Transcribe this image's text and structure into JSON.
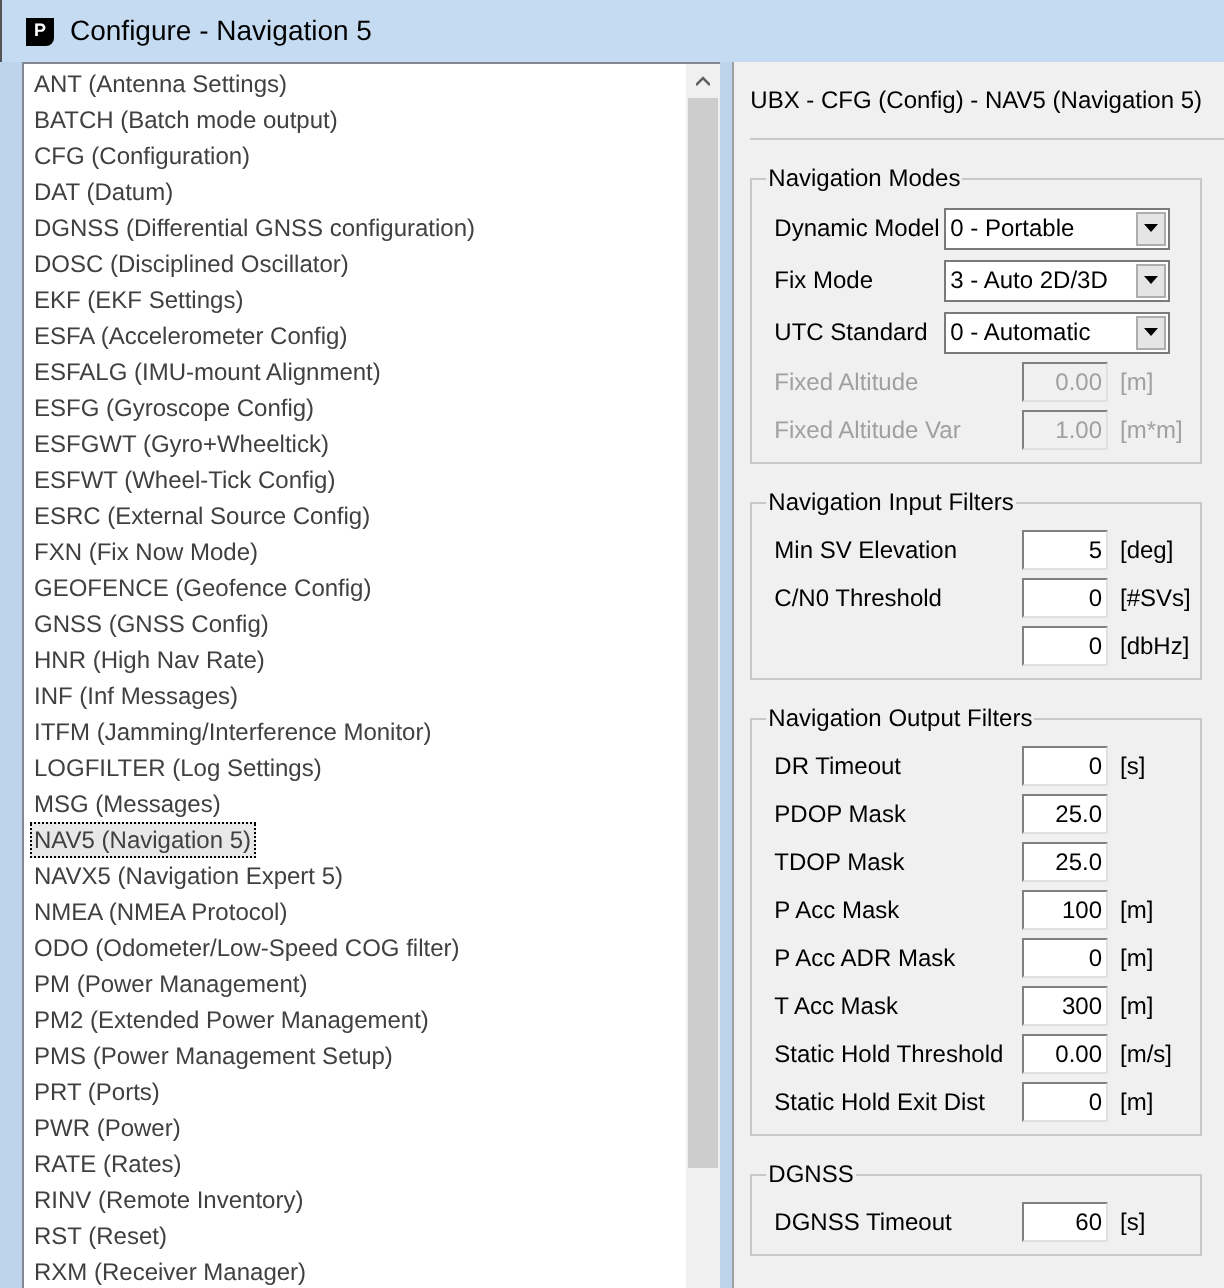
{
  "window": {
    "icon_letter": "P",
    "title": "Configure - Navigation 5"
  },
  "list": {
    "items": [
      {
        "label": "ANT (Antenna Settings)",
        "selected": false
      },
      {
        "label": "BATCH (Batch mode output)",
        "selected": false
      },
      {
        "label": "CFG (Configuration)",
        "selected": false
      },
      {
        "label": "DAT (Datum)",
        "selected": false
      },
      {
        "label": "DGNSS (Differential GNSS configuration)",
        "selected": false
      },
      {
        "label": "DOSC (Disciplined Oscillator)",
        "selected": false
      },
      {
        "label": "EKF (EKF Settings)",
        "selected": false
      },
      {
        "label": "ESFA (Accelerometer Config)",
        "selected": false
      },
      {
        "label": "ESFALG (IMU-mount Alignment)",
        "selected": false
      },
      {
        "label": "ESFG (Gyroscope Config)",
        "selected": false
      },
      {
        "label": "ESFGWT (Gyro+Wheeltick)",
        "selected": false
      },
      {
        "label": "ESFWT (Wheel-Tick Config)",
        "selected": false
      },
      {
        "label": "ESRC (External Source Config)",
        "selected": false
      },
      {
        "label": "FXN (Fix Now Mode)",
        "selected": false
      },
      {
        "label": "GEOFENCE (Geofence Config)",
        "selected": false
      },
      {
        "label": "GNSS (GNSS Config)",
        "selected": false
      },
      {
        "label": "HNR (High Nav Rate)",
        "selected": false
      },
      {
        "label": "INF (Inf Messages)",
        "selected": false
      },
      {
        "label": "ITFM (Jamming/Interference Monitor)",
        "selected": false
      },
      {
        "label": "LOGFILTER (Log Settings)",
        "selected": false
      },
      {
        "label": "MSG (Messages)",
        "selected": false
      },
      {
        "label": "NAV5 (Navigation 5)",
        "selected": true
      },
      {
        "label": "NAVX5 (Navigation Expert 5)",
        "selected": false
      },
      {
        "label": "NMEA (NMEA Protocol)",
        "selected": false
      },
      {
        "label": "ODO (Odometer/Low-Speed COG filter)",
        "selected": false
      },
      {
        "label": "PM (Power Management)",
        "selected": false
      },
      {
        "label": "PM2 (Extended Power Management)",
        "selected": false
      },
      {
        "label": "PMS (Power Management Setup)",
        "selected": false
      },
      {
        "label": "PRT (Ports)",
        "selected": false
      },
      {
        "label": "PWR (Power)",
        "selected": false
      },
      {
        "label": "RATE (Rates)",
        "selected": false
      },
      {
        "label": "RINV (Remote Inventory)",
        "selected": false
      },
      {
        "label": "RST (Reset)",
        "selected": false
      },
      {
        "label": "RXM (Receiver Manager)",
        "selected": false
      }
    ]
  },
  "panel": {
    "header": "UBX - CFG (Config) - NAV5 (Navigation 5)",
    "groups": [
      {
        "title": "Navigation Modes",
        "rows": [
          {
            "kind": "select",
            "label": "Dynamic Model",
            "value": "0 - Portable",
            "disabled": false
          },
          {
            "kind": "select",
            "label": "Fix Mode",
            "value": "3 - Auto 2D/3D",
            "disabled": false
          },
          {
            "kind": "select",
            "label": "UTC Standard",
            "value": "0 - Automatic",
            "disabled": false
          },
          {
            "kind": "number",
            "label": "Fixed Altitude",
            "value": "0.00",
            "unit": "[m]",
            "disabled": true
          },
          {
            "kind": "number",
            "label": "Fixed Altitude Var",
            "value": "1.00",
            "unit": "[m*m]",
            "disabled": true
          }
        ]
      },
      {
        "title": "Navigation Input Filters",
        "rows": [
          {
            "kind": "number",
            "label": "Min SV Elevation",
            "value": "5",
            "unit": "[deg]",
            "disabled": false
          },
          {
            "kind": "number",
            "label": "C/N0 Threshold",
            "value": "0",
            "unit": "[#SVs]",
            "disabled": false
          },
          {
            "kind": "number",
            "value": "0",
            "unit": "[dbHz]",
            "disabled": false
          }
        ]
      },
      {
        "title": "Navigation Output Filters",
        "rows": [
          {
            "kind": "number",
            "label": "DR Timeout",
            "value": "0",
            "unit": "[s]",
            "disabled": false
          },
          {
            "kind": "number",
            "label": "PDOP Mask",
            "value": "25.0",
            "disabled": false
          },
          {
            "kind": "number",
            "label": "TDOP Mask",
            "value": "25.0",
            "disabled": false
          },
          {
            "kind": "number",
            "label": "P Acc Mask",
            "value": "100",
            "unit": "[m]",
            "disabled": false
          },
          {
            "kind": "number",
            "label": "P Acc ADR Mask",
            "value": "0",
            "unit": "[m]",
            "disabled": false
          },
          {
            "kind": "number",
            "label": "T Acc Mask",
            "value": "300",
            "unit": "[m]",
            "disabled": false
          },
          {
            "kind": "number",
            "label": "Static Hold Threshold",
            "value": "0.00",
            "unit": "[m/s]",
            "disabled": false
          },
          {
            "kind": "number",
            "label": "Static Hold Exit Dist",
            "value": "0",
            "unit": "[m]",
            "disabled": false
          }
        ]
      },
      {
        "title": "DGNSS",
        "rows": [
          {
            "kind": "number",
            "label": "DGNSS Timeout",
            "value": "60",
            "unit": "[s]",
            "disabled": false
          }
        ]
      }
    ]
  }
}
